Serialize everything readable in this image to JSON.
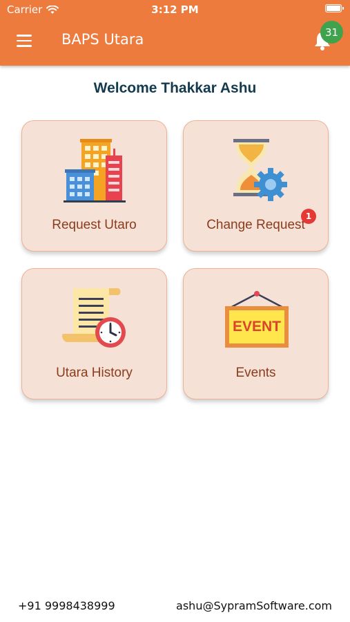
{
  "status_bar": {
    "carrier": "Carrier",
    "time": "3:12 PM"
  },
  "header": {
    "title": "BAPS Utara",
    "notification_count": "31"
  },
  "welcome_text": "Welcome Thakkar Ashu",
  "tiles": [
    {
      "label": "Request Utaro",
      "icon": "buildings-icon"
    },
    {
      "label": "Change Request",
      "icon": "hourglass-gear-icon",
      "badge": "1"
    },
    {
      "label": "Utara History",
      "icon": "scroll-clock-icon"
    },
    {
      "label": "Events",
      "icon": "event-board-icon",
      "board_text": "EVENT"
    }
  ],
  "footer": {
    "phone": "+91 9998438999",
    "email": "ashu@SypramSoftware.com"
  },
  "colors": {
    "header": "#ee7b3e",
    "tile_bg": "#f6e1d7",
    "tile_label": "#8a3c1d",
    "welcome": "#133b4f",
    "notif_badge": "#3fa34d",
    "request_badge": "#e53935"
  }
}
